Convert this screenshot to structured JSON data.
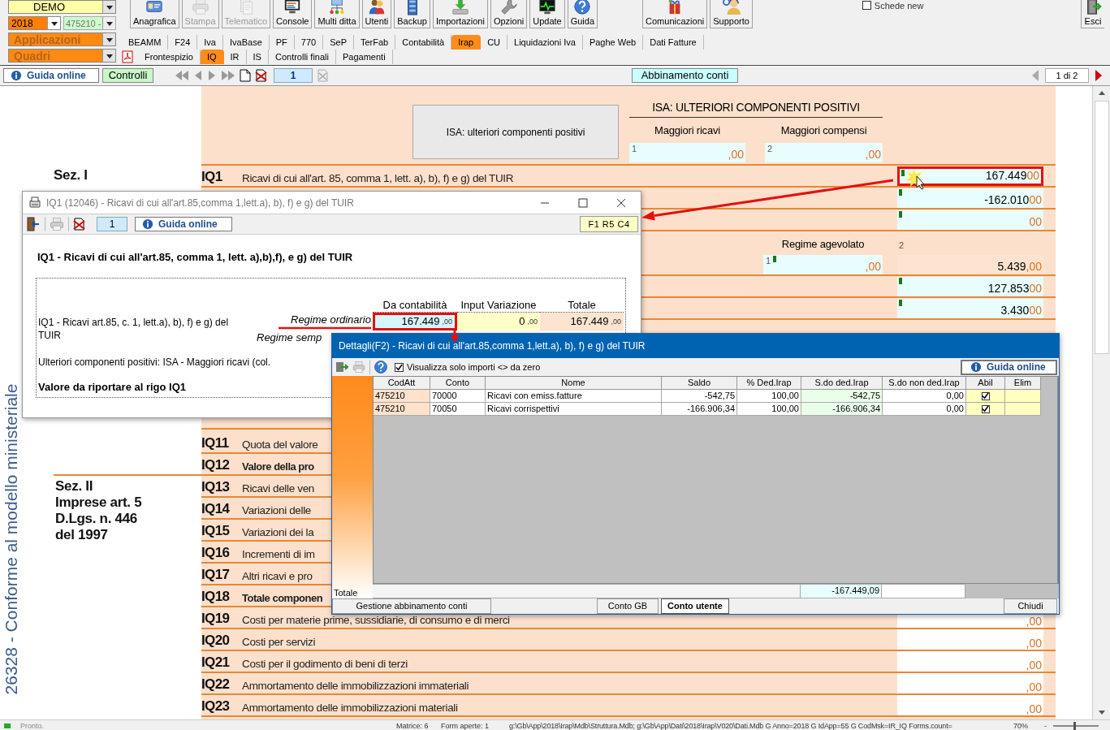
{
  "ditta": {
    "value": "DEMO"
  },
  "year": {
    "value": "2018"
  },
  "attivita": {
    "value": "475210 -",
    "disabled": true
  },
  "applicazioni": {
    "value": "Applicazioni"
  },
  "quadri": {
    "value": "Quadri"
  },
  "main_buttons": [
    {
      "label": "Anagrafica",
      "disabled": false
    },
    {
      "label": "Stampa",
      "disabled": true
    },
    {
      "label": "Telematico",
      "disabled": true
    },
    {
      "label": "Console",
      "disabled": false
    },
    {
      "label": "Multi ditta",
      "disabled": false
    },
    {
      "label": "Utenti",
      "disabled": false
    },
    {
      "label": "Backup",
      "disabled": false
    },
    {
      "label": "Importazioni",
      "disabled": false
    },
    {
      "label": "Opzioni",
      "disabled": false
    },
    {
      "label": "Update",
      "disabled": false
    },
    {
      "label": "Guida",
      "disabled": false
    }
  ],
  "service_buttons": [
    {
      "label": "Comunicazioni"
    },
    {
      "label": "Supporto"
    }
  ],
  "schede_new": {
    "label": "Schede new",
    "checked": false
  },
  "exit_button": {
    "label": "Esci"
  },
  "app_tabs": [
    {
      "label": "BEAMM",
      "selected": false
    },
    {
      "label": "F24",
      "selected": false
    },
    {
      "label": "Iva",
      "selected": false
    },
    {
      "label": "IvaBase",
      "selected": false
    },
    {
      "label": "PF",
      "selected": false
    },
    {
      "label": "770",
      "selected": false
    },
    {
      "label": "SeP",
      "selected": false
    },
    {
      "label": "TerFab",
      "selected": false
    },
    {
      "label": "Contabilità",
      "selected": false
    },
    {
      "label": "Irap",
      "selected": true
    },
    {
      "label": "CU",
      "selected": false
    },
    {
      "label": "Liquidazioni Iva",
      "selected": false
    },
    {
      "label": "Paghe Web",
      "selected": false
    },
    {
      "label": "Dati Fatture",
      "selected": false
    }
  ],
  "quadri_tabs": [
    {
      "label": "Frontespizio",
      "selected": false
    },
    {
      "label": "IQ",
      "selected": true
    },
    {
      "label": "IR",
      "selected": false
    },
    {
      "label": "IS",
      "selected": false
    },
    {
      "label": "Controlli finali",
      "selected": false
    },
    {
      "label": "Pagamenti",
      "selected": false
    }
  ],
  "nav": {
    "guida": "Guida online",
    "controlli": "Controlli",
    "page": "1",
    "abbinamento": "Abbinamento conti",
    "pager": "1 di 2"
  },
  "form": {
    "side_text": "26328 - Conforme al modello ministeriale",
    "sections": [
      {
        "lines": [
          "Sez. I"
        ]
      },
      {
        "lines": [
          "Sez. II",
          "Imprese art. 5",
          "D.Lgs. n. 446",
          "del 1997"
        ]
      }
    ],
    "isa_button": "ISA: ulteriori componenti positivi",
    "isa_title": "ISA: ULTERIORI COMPONENTI POSITIVI",
    "isa_fields": [
      {
        "label": "Maggiori ricavi",
        "number": "1",
        "decimals": ",00"
      },
      {
        "label": "Maggiori compensi",
        "number": "2",
        "decimals": ",00"
      }
    ],
    "top_rows": [
      {
        "kind": "line",
        "code": "IQ1",
        "label": "Ricavi di cui all'art. 85, comma 1, lett. a), b), f) e g) del TUIR",
        "value": "167.449",
        "decimals": "00",
        "marker": true,
        "highlighted": true
      },
      {
        "kind": "line",
        "value": "-162.010",
        "decimals": "00",
        "marker": true,
        "highlighted": false
      },
      {
        "kind": "line",
        "decimals": "00",
        "marker": true,
        "highlighted": false
      },
      {
        "kind": "split",
        "label": "Regime agevolato",
        "left": {
          "number": "1",
          "marker": true,
          "decimals": ",00"
        },
        "right_number": "2",
        "right": {
          "value": "5.439",
          "decimals": ",00"
        }
      },
      {
        "kind": "line",
        "value": "127.853",
        "decimals": "00",
        "marker": true,
        "highlighted": false
      },
      {
        "kind": "line",
        "value": "3.430",
        "decimals": "00",
        "marker": true,
        "highlighted": false
      }
    ],
    "rows": [
      {
        "code": "IQ11",
        "label": "Quota del valore",
        "bold": false
      },
      {
        "code": "IQ12",
        "label": "Valore della pro",
        "bold": true
      },
      {
        "code": "IQ13",
        "label": "Ricavi delle ven",
        "bold": false
      },
      {
        "code": "IQ14",
        "label": "Variazioni delle",
        "bold": false
      },
      {
        "code": "IQ15",
        "label": "Variazioni dei la",
        "bold": false
      },
      {
        "code": "IQ16",
        "label": "Incrementi di im",
        "bold": false
      },
      {
        "code": "IQ17",
        "label": "Altri ricavi e pro",
        "bold": false
      },
      {
        "code": "IQ18",
        "label": "Totale componen",
        "bold": true
      },
      {
        "code": "IQ19",
        "label": "Costi per materie prime, sussidiarie, di consumo e di merci",
        "bold": false,
        "decimals": ",00"
      },
      {
        "code": "IQ20",
        "label": "Costi per servizi",
        "bold": false,
        "decimals": ",00"
      },
      {
        "code": "IQ21",
        "label": "Costi per il godimento di beni di terzi",
        "bold": false,
        "decimals": ",00"
      },
      {
        "code": "IQ22",
        "label": "Ammortamento delle immobilizzazioni immateriali",
        "bold": false,
        "decimals": ",00"
      },
      {
        "code": "IQ23",
        "label": "Ammortamento delle immobilizzazioni materiali",
        "bold": false,
        "decimals": ",00"
      }
    ]
  },
  "iq1_dialog": {
    "title": "IQ1 (12046) - Ricavi di cui all'art.85,comma 1,lett.a), b), f) e g) del TUIR",
    "page": "1",
    "guida": "Guida online",
    "cell_ref": "F1 R5 C4",
    "heading": "IQ1 - Ricavi di cui all'art.85, comma 1, lett. a),b),f), e g) del TUIR",
    "columns": [
      "Da contabilità",
      "Input Variazione",
      "Totale"
    ],
    "row_label": "IQ1  - Ricavi art.85, c. 1, lett.a), b), f) e g) del TUIR",
    "regimes": [
      {
        "label": "Regime ordinario",
        "values": [
          {
            "value": "167.449",
            "decimals": ",00",
            "highlighted": true
          },
          {
            "value": "0",
            "decimals": ",00",
            "highlighted": false
          },
          {
            "value": "167.449",
            "decimals": ",00",
            "highlighted": false
          }
        ]
      },
      {
        "label": "Regime semp"
      }
    ],
    "notes": [
      {
        "text": "Ulteriori componenti positivi: ISA - Maggiori ricavi (col.",
        "bold": false
      },
      {
        "text": "Valore da riportare al rigo IQ1",
        "bold": true
      }
    ]
  },
  "dettagli": {
    "title": "Dettagli(F2) - Ricavi di cui all'art.85,comma 1,lett.a), b), f) e g) del TUIR",
    "filter": {
      "label": "Visualizza solo importi <> da zero",
      "checked": true
    },
    "guida": "Guida online",
    "columns": [
      "CodAtt",
      "Conto",
      "Nome",
      "Saldo",
      "% Ded.Irap",
      "S.do ded.Irap",
      "S.do non ded.Irap",
      "Abil",
      "Elim"
    ],
    "rows": [
      {
        "cells": [
          "475210",
          "70000",
          "Ricavi con emiss.fatture",
          "-542,75",
          "100,00",
          "-542,75",
          "0,00"
        ],
        "abil": true
      },
      {
        "cells": [
          "475210",
          "70050",
          "Ricavi corrispettivi",
          "-166.906,34",
          "100,00",
          "-166.906,34",
          "0,00"
        ],
        "abil": true
      }
    ],
    "total_label": "Totale",
    "total": "-167.449,09",
    "buttons": [
      {
        "label": "Gestione abbinamento conti",
        "selected": false
      },
      {
        "label": "Conto GB",
        "selected": false
      },
      {
        "label": "Conto utente",
        "selected": true
      },
      {
        "label": "Chiudi",
        "selected": false
      }
    ]
  },
  "status_bar": {
    "state": "Pronto.",
    "matrice": "Matrice: 6",
    "forms": "Form aperte: 1",
    "path": "g:\\Gb\\App\\2018\\Irap\\Mdb\\Struttura.Mdb; g:\\Gb\\App\\Dati\\2018\\Irap\\V020\\Dati.Mdb G  Anno=2018 G  IdApp=55 G  CodMsk=IR_IQ Forms.count=",
    "zoom": "70%",
    "zoom_out": "-",
    "zoom_slider": {
      "level": 0.45
    }
  }
}
